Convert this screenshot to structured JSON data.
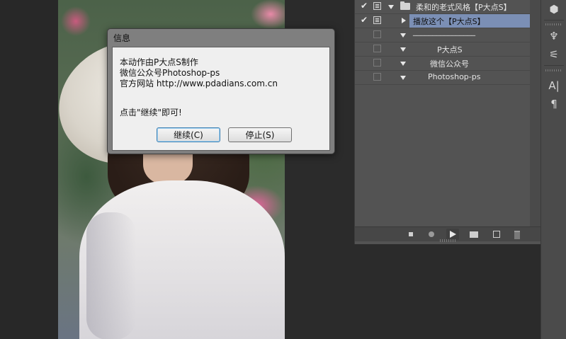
{
  "dialog": {
    "title": "信息",
    "lines": [
      "本动作由P大点S制作",
      "微信公众号Photoshop-ps",
      "官方网站 http://www.pdadians.com.cn"
    ],
    "prompt": "点击\"继续\"即可!",
    "continue_label": "继续(C)",
    "stop_label": "停止(S)"
  },
  "actions_panel": {
    "rows": [
      {
        "label": "柔和的老式风格【P大点S】",
        "checked": true,
        "toggle": true,
        "expand": "down",
        "folder": true
      },
      {
        "label": "播放这个【P大点S】",
        "checked": true,
        "toggle": true,
        "expand": "right",
        "selected": true
      },
      {
        "label": "________________",
        "checked": false,
        "toggle": false,
        "expand": "down"
      },
      {
        "label": "P大点S",
        "checked": false,
        "toggle": false,
        "expand": "down"
      },
      {
        "label": "微信公众号",
        "checked": false,
        "toggle": false,
        "expand": "down"
      },
      {
        "label": "Photoshop-ps",
        "checked": false,
        "toggle": false,
        "expand": "down"
      }
    ],
    "check_glyph": "✔"
  },
  "right_toolbar": {
    "icons": [
      "3d-cube-icon",
      "brush-icon",
      "adjust-icon",
      "character-icon",
      "paragraph-icon"
    ],
    "character_glyph": "A|",
    "paragraph_glyph": "¶"
  },
  "colors": {
    "panel_bg": "#535353",
    "selected_row": "#7b8fb5",
    "dialog_body": "#efefef",
    "default_button_border": "#3c7fb1"
  }
}
